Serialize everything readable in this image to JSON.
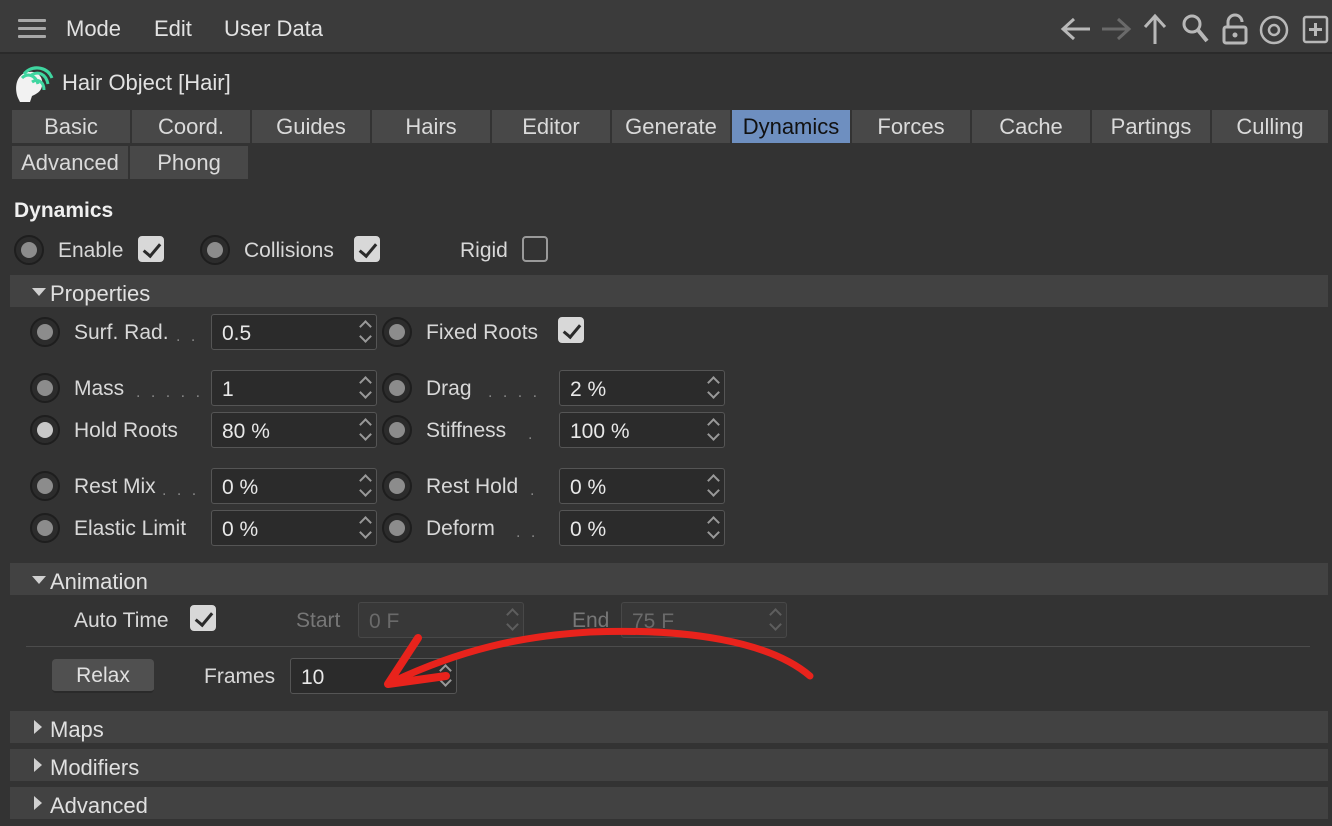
{
  "menu": {
    "items": [
      "Mode",
      "Edit",
      "User Data"
    ]
  },
  "object": {
    "title": "Hair Object [Hair]"
  },
  "tabs": [
    "Basic",
    "Coord.",
    "Guides",
    "Hairs",
    "Editor",
    "Generate",
    "Dynamics",
    "Forces",
    "Cache",
    "Partings",
    "Culling",
    "Advanced",
    "Phong"
  ],
  "active_tab": "Dynamics",
  "section_title": "Dynamics",
  "toggles": {
    "enable": "Enable",
    "collisions": "Collisions",
    "rigid": "Rigid"
  },
  "properties": {
    "header": "Properties",
    "surf_rad": {
      "label": "Surf. Rad.",
      "value": "0.5"
    },
    "fixed_roots": {
      "label": "Fixed Roots"
    },
    "mass": {
      "label": "Mass",
      "value": "1"
    },
    "drag": {
      "label": "Drag",
      "value": "2 %"
    },
    "hold_roots": {
      "label": "Hold Roots",
      "value": "80 %"
    },
    "stiffness": {
      "label": "Stiffness",
      "value": "100 %"
    },
    "rest_mix": {
      "label": "Rest Mix",
      "value": "0 %"
    },
    "rest_hold": {
      "label": "Rest Hold",
      "value": "0 %"
    },
    "elastic_limit": {
      "label": "Elastic Limit",
      "value": "0 %"
    },
    "deform": {
      "label": "Deform",
      "value": "0 %"
    }
  },
  "animation": {
    "header": "Animation",
    "auto_time": "Auto Time",
    "start": {
      "label": "Start",
      "value": "0 F"
    },
    "end": {
      "label": "End",
      "value": "75 F"
    },
    "relax": "Relax",
    "frames": {
      "label": "Frames",
      "value": "10"
    }
  },
  "collapsed_sections": {
    "maps": "Maps",
    "modifiers": "Modifiers",
    "advanced": "Advanced"
  },
  "colors": {
    "accent_tab": "#6e8fc0",
    "annotation_arrow": "#e8231c",
    "hair_icon": "#3fd6a0"
  },
  "icons": [
    "hamburger-icon",
    "back-arrow-icon",
    "forward-arrow-icon",
    "up-arrow-icon",
    "search-icon",
    "lock-icon",
    "target-icon",
    "new-panel-icon",
    "hair-object-icon"
  ]
}
